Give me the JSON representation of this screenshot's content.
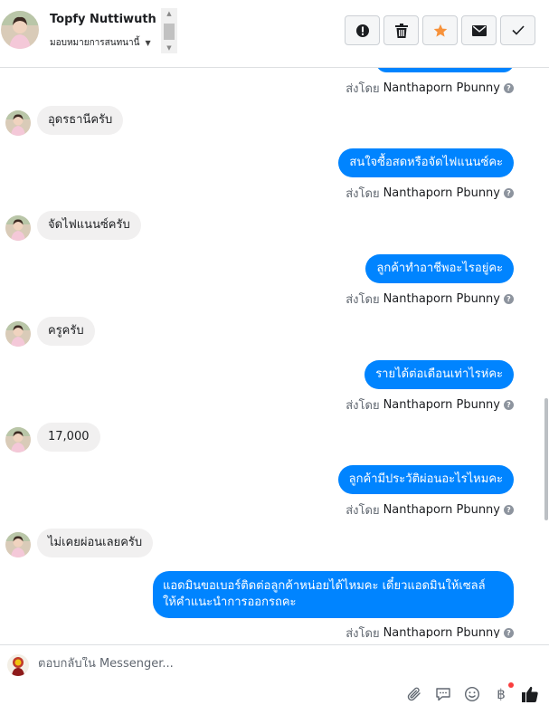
{
  "header": {
    "contact_name": "Topfy Nuttiwuth",
    "assign_label": "มอบหมายการสนทนานี้",
    "buttons": [
      {
        "name": "mark-spam",
        "icon": "alert-icon"
      },
      {
        "name": "delete",
        "icon": "trash-icon"
      },
      {
        "name": "star",
        "icon": "star-icon"
      },
      {
        "name": "mark-unread",
        "icon": "envelope-icon"
      },
      {
        "name": "done",
        "icon": "check-icon"
      }
    ],
    "accent_star_color": "#f7923b"
  },
  "messages": [
    {
      "from": "page",
      "text": "",
      "sent_by_prefix": "ส่งโดย",
      "sent_by": "Nanthaporn Pbunny"
    },
    {
      "from": "customer",
      "text": "อุดรธานีครับ"
    },
    {
      "from": "page",
      "text": "สนใจซื้อสดหรือจัดไฟแนนซ์คะ",
      "sent_by_prefix": "ส่งโดย",
      "sent_by": "Nanthaporn Pbunny"
    },
    {
      "from": "customer",
      "text": "จัดไฟแนนซ์ครับ"
    },
    {
      "from": "page",
      "text": "ลูกค้าทำอาชีพอะไรอยู่คะ",
      "sent_by_prefix": "ส่งโดย",
      "sent_by": "Nanthaporn Pbunny"
    },
    {
      "from": "customer",
      "text": "ครูครับ"
    },
    {
      "from": "page",
      "text": "รายได้ต่อเดือนเท่าไรห่คะ",
      "sent_by_prefix": "ส่งโดย",
      "sent_by": "Nanthaporn Pbunny"
    },
    {
      "from": "customer",
      "text": "17,000"
    },
    {
      "from": "page",
      "text": "ลูกค้ามีประวัติผ่อนอะไรไหมคะ",
      "sent_by_prefix": "ส่งโดย",
      "sent_by": "Nanthaporn Pbunny"
    },
    {
      "from": "customer",
      "text": "ไม่เคยผ่อนเลยครับ"
    },
    {
      "from": "page",
      "text_line1": "แอดมินขอเบอร์ติดต่อลูกค้าหน่อยได้ไหมคะ เดี๋ยวแอดมินให้เซลล์",
      "text_line2": "ให้คำแนะนำการออกรถคะ",
      "sent_by_prefix": "ส่งโดย",
      "sent_by": "Nanthaporn Pbunny"
    }
  ],
  "composer": {
    "placeholder": "ตอบกลับใน Messenger...",
    "icons": [
      "attachment-icon",
      "saved-replies-icon",
      "emoji-icon",
      "baht-payment-icon",
      "like-icon"
    ]
  },
  "colors": {
    "outgoing_bubble": "#0084ff",
    "incoming_bubble": "#f1f0f0",
    "like_icon": "#0084ff"
  }
}
